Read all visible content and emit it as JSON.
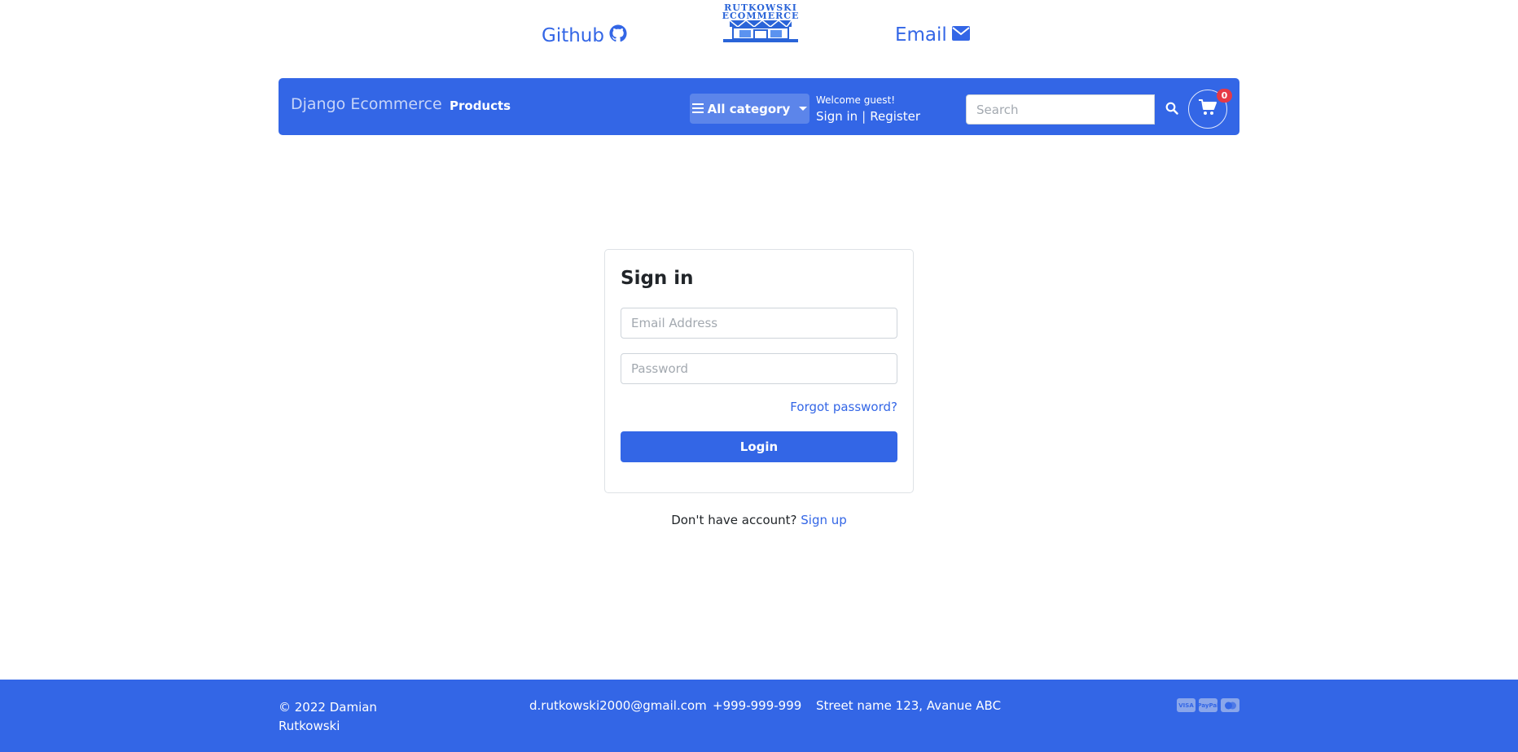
{
  "top": {
    "github_label": "Github",
    "email_label": "Email",
    "logo_line1": "RUTKOWSKI",
    "logo_line2": "ECOMMERCE"
  },
  "navbar": {
    "brand": "Django Ecommerce",
    "products": "Products",
    "category_button": "All category",
    "welcome": "Welcome guest!",
    "sign_in": "Sign in",
    "separator": "|",
    "register": "Register",
    "search_placeholder": "Search",
    "cart_count": "0"
  },
  "signin": {
    "title": "Sign in",
    "email_placeholder": "Email Address",
    "password_placeholder": "Password",
    "forgot": "Forgot password?",
    "login": "Login",
    "no_account": "Don't have account?",
    "signup": "Sign up"
  },
  "footer": {
    "copyright": "© 2022 Damian Rutkowski",
    "email": "d.rutkowski2000@gmail.com",
    "phone": "+999-999-999",
    "address": "Street name 123, Avanue ABC",
    "payments": [
      "VISA",
      "PayPal",
      "MC"
    ]
  },
  "colors": {
    "primary": "#3366e6",
    "badge": "#e63946"
  }
}
